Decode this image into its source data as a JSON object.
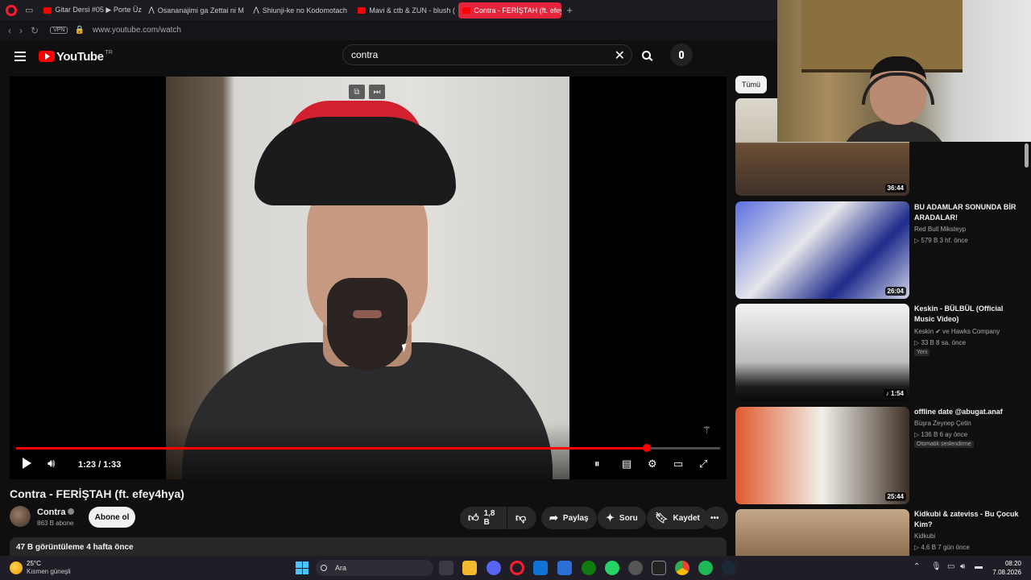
{
  "browser": {
    "tabs": [
      {
        "label": "Gitar Dersi #05 ▶ Porte Üz",
        "favicon": "yt"
      },
      {
        "label": "Osananajimi ga Zettai ni M",
        "favicon": "web"
      },
      {
        "label": "Shiunji-ke no Kodomotach",
        "favicon": "web"
      },
      {
        "label": "Mavi & ctb & ZUN - blush (",
        "favicon": "yt"
      },
      {
        "label": "Contra - FERİŞTAH (ft. efey",
        "favicon": "yt",
        "active": true
      }
    ],
    "tab_add": "+",
    "vpn_label": "VPN",
    "url": "www.youtube.com/watch"
  },
  "youtube": {
    "logo_text": "YouTube",
    "country_code": "TR",
    "search_value": "contra"
  },
  "player": {
    "time": "1:23 / 1:33",
    "progress": 0.896
  },
  "video": {
    "title": "Contra - FERİŞTAH (ft. efey4hya)",
    "channel": "Contra",
    "subscribers": "863 B abone",
    "subscribe_label": "Abone ol",
    "likes": "1,8 B",
    "share_label": "Paylaş",
    "ask_label": "Soru",
    "save_label": "Kaydet",
    "views_date": "47 B görüntüleme  4 hafta önce"
  },
  "sidebar": {
    "chip": "Tümü",
    "items": [
      {
        "duration": "36:44"
      },
      {
        "title": "BU ADAMLAR SONUNDA BİR ARADALAR!",
        "channel": "Red Bull Miksteyp",
        "meta": "▷ 579 B  3 hf. önce",
        "duration": "26:04"
      },
      {
        "title": "Keskin - BÜLBÜL (Official Music Video)",
        "channel": "Keskin ✔ ve Hawks Company",
        "meta": "▷ 33 B  8 sa. önce",
        "badge": "Yeni",
        "duration": "♪ 1:54"
      },
      {
        "title": "offline date @abugat.anaf",
        "channel": "Büşra Zeynep Çetin",
        "meta": "▷ 136 B  6 ay önce",
        "badge": "Otomatik seslendirme",
        "duration": "25:44"
      },
      {
        "title": "Kidkubi & zateviss - Bu Çocuk Kim?",
        "channel": "Kidkubi",
        "meta": "▷ 4,6 B  7 gün önce"
      }
    ]
  },
  "taskbar": {
    "temperature": "25°C",
    "weather": "Kısmen güneşli",
    "search_label": "Ara",
    "time": "08:20",
    "date": "7.08.2026"
  },
  "colors": {
    "accent": "#ff0000",
    "opera": "#ff1b2d",
    "bg": "#0f0f0f"
  }
}
